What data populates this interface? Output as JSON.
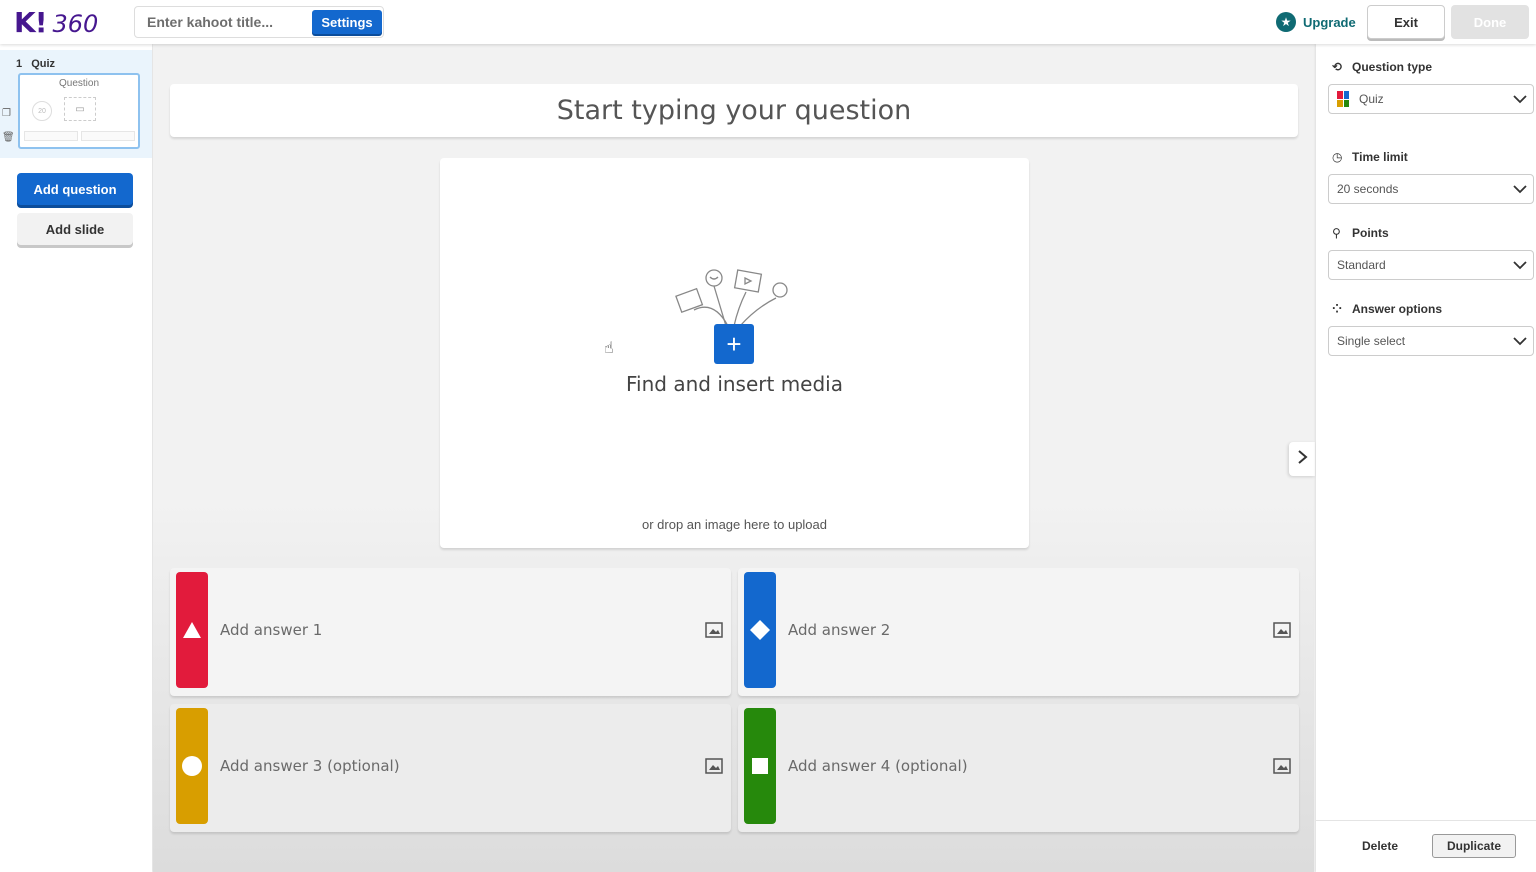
{
  "header": {
    "logo_k": "K!",
    "logo_num": "360",
    "title_placeholder": "Enter kahoot title...",
    "settings_label": "Settings",
    "upgrade_label": "Upgrade",
    "exit_label": "Exit",
    "done_label": "Done"
  },
  "sidebar": {
    "slide_number": "1",
    "slide_type": "Quiz",
    "thumb_label": "Question",
    "thumb_timer": "20",
    "add_question_label": "Add question",
    "add_slide_label": "Add slide"
  },
  "editor": {
    "question_placeholder": "Start typing your question",
    "media_title": "Find and insert media",
    "media_hint": "or drop an image here to upload",
    "answers": [
      {
        "placeholder": "Add answer 1",
        "color": "#e21b3c",
        "shape": "triangle-icon"
      },
      {
        "placeholder": "Add answer 2",
        "color": "#1368ce",
        "shape": "diamond-icon"
      },
      {
        "placeholder": "Add answer 3 (optional)",
        "color": "#d89e00",
        "shape": "circle-icon"
      },
      {
        "placeholder": "Add answer 4 (optional)",
        "color": "#26890c",
        "shape": "square-icon"
      }
    ]
  },
  "panel": {
    "question_type_label": "Question type",
    "question_type_value": "Quiz",
    "time_limit_label": "Time limit",
    "time_limit_value": "20 seconds",
    "points_label": "Points",
    "points_value": "Standard",
    "answer_options_label": "Answer options",
    "answer_options_value": "Single select",
    "delete_label": "Delete",
    "duplicate_label": "Duplicate"
  },
  "colors": {
    "brand": "#46178f",
    "primary": "#1368ce",
    "upgrade": "#0f6a73"
  }
}
